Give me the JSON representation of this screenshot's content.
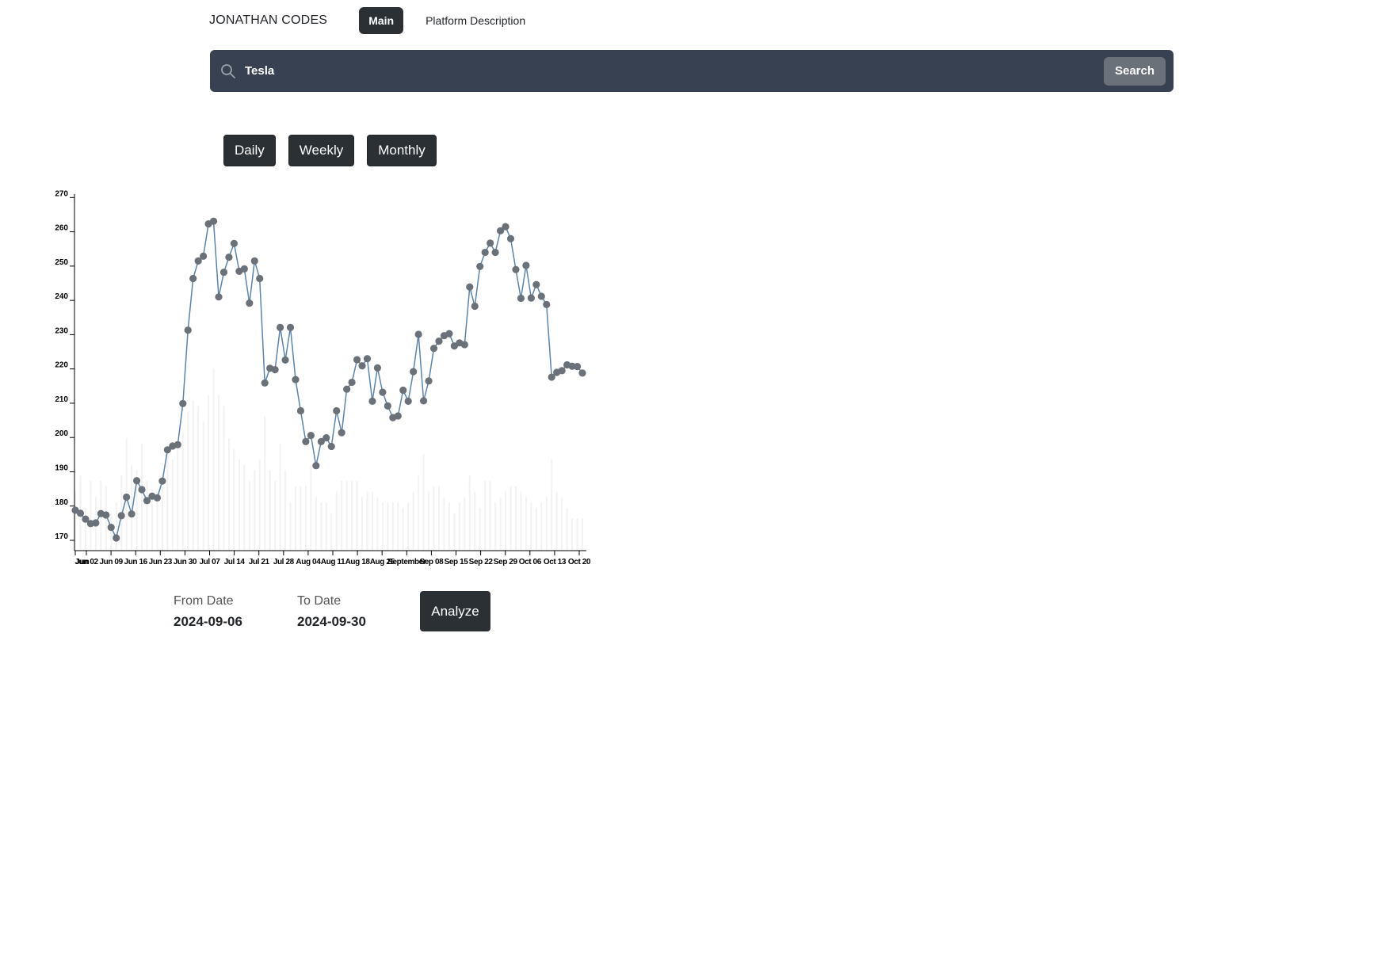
{
  "navbar": {
    "brand": "JONATHAN CODES",
    "links": [
      {
        "label": "Main",
        "active": true
      },
      {
        "label": "Platform Description",
        "active": false
      }
    ]
  },
  "search": {
    "value": "Tesla",
    "button_label": "Search",
    "icon": "search-icon"
  },
  "periods": [
    "Daily",
    "Weekly",
    "Monthly"
  ],
  "colors": {
    "line": "#5b84a8",
    "point": "#6b7178",
    "volume": "#f2f2f2",
    "dark": "#2b3035",
    "search_bg": "#374151"
  },
  "chart_data": {
    "type": "line",
    "title": "",
    "xlabel": "",
    "ylabel": "",
    "ylim": [
      167,
      271
    ],
    "y_ticks": [
      170,
      180,
      190,
      200,
      210,
      220,
      230,
      240,
      250,
      260,
      270
    ],
    "x_tick_labels": [
      "Jun 02",
      "Jun 09",
      "Jun 16",
      "Jun 23",
      "Jun 30",
      "Jul 07",
      "Jul 14",
      "Jul 21",
      "Jul 28",
      "Aug 04",
      "Aug 11",
      "Aug 18",
      "Aug 25",
      "September",
      "Sep 08",
      "Sep 15",
      "Sep 22",
      "Sep 29",
      "Oct 06",
      "Oct 13",
      "Oct 20"
    ],
    "x_start_label": "Jun",
    "series": [
      {
        "values": [
          178.8,
          177.9,
          176.2,
          174.9,
          175.1,
          177.8,
          177.4,
          173.8,
          170.7,
          177.2,
          182.6,
          177.7,
          187.4,
          184.8,
          181.6,
          182.9,
          182.4,
          187.3,
          196.4,
          197.5,
          197.9,
          209.9,
          231.3,
          246.4,
          251.5,
          252.9,
          262.3,
          263.1,
          241.0,
          248.2,
          252.6,
          256.6,
          248.5,
          249.2,
          239.2,
          251.5,
          246.4,
          215.9,
          220.2,
          219.8,
          232.1,
          222.6,
          232.1,
          216.9,
          207.8,
          198.8,
          200.6,
          191.8,
          198.8,
          199.9,
          197.4,
          207.8,
          201.4,
          214.1,
          216.1,
          222.7,
          220.9,
          223.0,
          210.6,
          220.3,
          213.2,
          209.2,
          205.8,
          206.3,
          213.8,
          210.6,
          219.2,
          230.1,
          210.7,
          216.5,
          226.0,
          228.1,
          229.7,
          230.3,
          226.7,
          227.6,
          227.1,
          243.9,
          238.3,
          249.9,
          254.0,
          256.7,
          254.0,
          260.3,
          261.5,
          258.0,
          249.0,
          240.6,
          250.2,
          240.7,
          244.6,
          241.2,
          238.8,
          217.6,
          219.0,
          219.5,
          221.2,
          220.8,
          220.7,
          218.8
        ],
        "volume": [
          1.1,
          1.4,
          0.8,
          1.3,
          1.0,
          1.3,
          1.2,
          0.7,
          0.9,
          1.4,
          2.1,
          1.6,
          1.5,
          2.0,
          1.3,
          1.0,
          1.1,
          1.2,
          1.8,
          1.7,
          1.9,
          2.2,
          2.6,
          2.8,
          2.7,
          2.4,
          2.9,
          3.4,
          2.9,
          2.7,
          2.1,
          1.9,
          1.7,
          1.6,
          1.3,
          1.5,
          1.7,
          2.5,
          1.5,
          1.3,
          2.0,
          1.5,
          0.9,
          1.2,
          1.2,
          1.2,
          1.6,
          1.0,
          0.9,
          0.9,
          0.7,
          1.1,
          1.3,
          1.3,
          1.3,
          1.3,
          1.0,
          1.1,
          1.1,
          1.0,
          0.9,
          0.9,
          0.9,
          0.9,
          0.8,
          0.9,
          1.1,
          1.4,
          1.8,
          1.1,
          1.2,
          1.2,
          1.0,
          0.9,
          0.7,
          0.9,
          1.0,
          1.4,
          1.1,
          0.8,
          1.3,
          1.3,
          0.9,
          1.0,
          1.1,
          1.2,
          1.2,
          1.1,
          1.0,
          0.9,
          0.8,
          0.9,
          1.0,
          1.7,
          1.1,
          1.0,
          0.8,
          0.6,
          0.6,
          0.6
        ]
      }
    ]
  },
  "range": {
    "from_label": "From Date",
    "from_value": "2024-09-06",
    "to_label": "To Date",
    "to_value": "2024-09-30",
    "analyze_label": "Analyze"
  }
}
